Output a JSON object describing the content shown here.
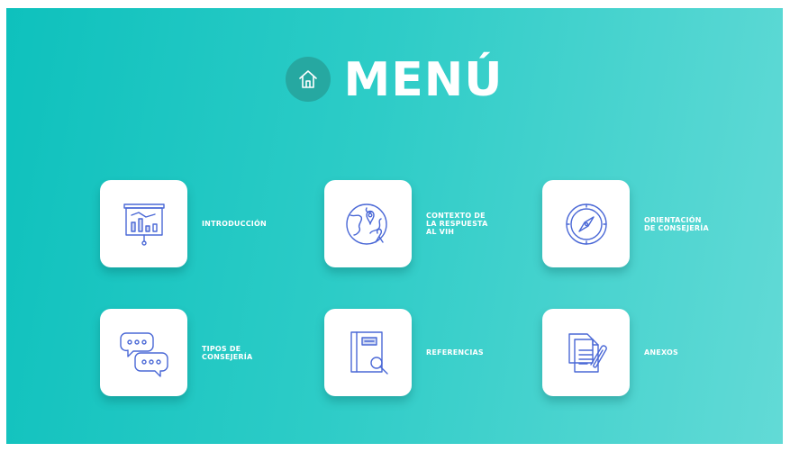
{
  "header": {
    "title": "MENÚ"
  },
  "menu": {
    "items": [
      {
        "label": "INTRODUCCIÓN",
        "icon": "presentation-chart-icon"
      },
      {
        "label": "CONTEXTO DE\nLA RESPUESTA\nAL VIH",
        "icon": "globe-ribbon-icon"
      },
      {
        "label": "ORIENTACIÓN\nDE CONSEJERÍA",
        "icon": "compass-icon"
      },
      {
        "label": "TIPOS DE\nCONSEJERÍA",
        "icon": "chat-bubbles-icon"
      },
      {
        "label": "REFERENCIAS",
        "icon": "book-search-icon"
      },
      {
        "label": "ANEXOS",
        "icon": "documents-clip-icon"
      }
    ]
  },
  "colors": {
    "bg_start": "#0ec1bd",
    "bg_end": "#62dad6",
    "icon_stroke": "#4a68d6",
    "home_circle": "#26a8a1"
  }
}
